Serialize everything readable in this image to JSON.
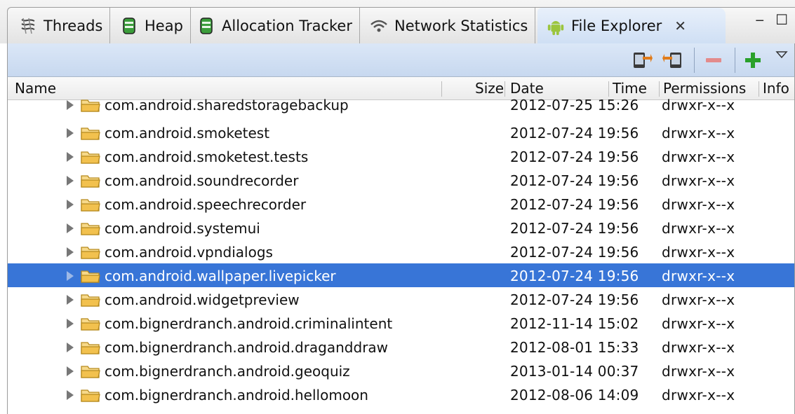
{
  "tabs": [
    {
      "label": "Threads",
      "icon": "threads-icon"
    },
    {
      "label": "Heap",
      "icon": "heap-icon"
    },
    {
      "label": "Allocation Tracker",
      "icon": "allocation-icon"
    },
    {
      "label": "Network Statistics",
      "icon": "wifi-icon"
    },
    {
      "label": "File Explorer",
      "icon": "android-icon",
      "active": true,
      "close": "✕"
    }
  ],
  "window": {
    "minimize": "‒",
    "maximize": "☐"
  },
  "toolbar": {
    "pull_file": "pull-file-icon",
    "push_file": "push-file-icon",
    "delete": "delete-icon",
    "new_folder": "add-icon",
    "menu": "view-menu-icon"
  },
  "columns": {
    "name": "Name",
    "size": "Size",
    "date": "Date",
    "time": "Time",
    "permissions": "Permissions",
    "info": "Info"
  },
  "colors": {
    "selection": "#3875d7",
    "folder": "#f2c14e",
    "add": "#2aa02a",
    "delete": "#e05a5a"
  },
  "rows": [
    {
      "name": "com.android.sharedstoragebackup",
      "date": "2012-07-25",
      "time": "15:26",
      "perm": "drwxr-x--x"
    },
    {
      "name": "com.android.smoketest",
      "date": "2012-07-24",
      "time": "19:56",
      "perm": "drwxr-x--x"
    },
    {
      "name": "com.android.smoketest.tests",
      "date": "2012-07-24",
      "time": "19:56",
      "perm": "drwxr-x--x"
    },
    {
      "name": "com.android.soundrecorder",
      "date": "2012-07-24",
      "time": "19:56",
      "perm": "drwxr-x--x"
    },
    {
      "name": "com.android.speechrecorder",
      "date": "2012-07-24",
      "time": "19:56",
      "perm": "drwxr-x--x"
    },
    {
      "name": "com.android.systemui",
      "date": "2012-07-24",
      "time": "19:56",
      "perm": "drwxr-x--x"
    },
    {
      "name": "com.android.vpndialogs",
      "date": "2012-07-24",
      "time": "19:56",
      "perm": "drwxr-x--x"
    },
    {
      "name": "com.android.wallpaper.livepicker",
      "date": "2012-07-24",
      "time": "19:56",
      "perm": "drwxr-x--x",
      "selected": true
    },
    {
      "name": "com.android.widgetpreview",
      "date": "2012-07-24",
      "time": "19:56",
      "perm": "drwxr-x--x"
    },
    {
      "name": "com.bignerdranch.android.criminalintent",
      "date": "2012-11-14",
      "time": "15:02",
      "perm": "drwxr-x--x"
    },
    {
      "name": "com.bignerdranch.android.draganddraw",
      "date": "2012-08-01",
      "time": "15:33",
      "perm": "drwxr-x--x"
    },
    {
      "name": "com.bignerdranch.android.geoquiz",
      "date": "2013-01-14",
      "time": "00:37",
      "perm": "drwxr-x--x"
    },
    {
      "name": "com.bignerdranch.android.hellomoon",
      "date": "2012-08-06",
      "time": "14:09",
      "perm": "drwxr-x--x"
    }
  ]
}
